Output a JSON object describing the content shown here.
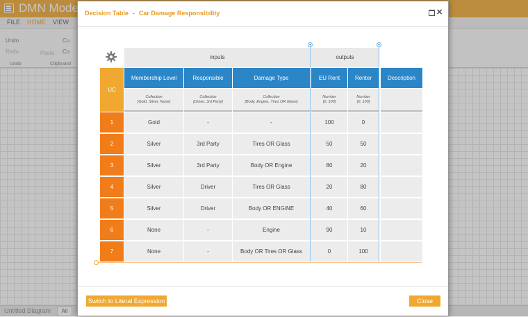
{
  "app": {
    "title": "DMN Modeler",
    "menu": [
      "FILE",
      "HOME",
      "VIEW"
    ],
    "ribbon": {
      "undo": "Undo",
      "redo": "Redo",
      "paste": "Paste",
      "cut": "Cu",
      "copy": "Co",
      "group_undo": "Undo",
      "group_clipboard": "Clipboard"
    },
    "bottom": {
      "diagram_tab": "Untitled Diagram",
      "filter": "All"
    }
  },
  "dialog": {
    "title": "Decision Table",
    "separator": "-",
    "subtitle": "Car Damage Responsibility",
    "switch_button": "Switch to Literal Expression",
    "close_button": "Close",
    "icons": [
      "maximize-icon",
      "close-icon",
      "gear-icon"
    ]
  },
  "table": {
    "hit_policy": "UC",
    "inputs_label": "inputs",
    "outputs_label": "outputs",
    "columns": [
      {
        "label": "Membership Level",
        "type": "Collection",
        "domain": "[Gold, Silver, None]"
      },
      {
        "label": "Responsible",
        "type": "Collection",
        "domain": "[Driver, 3rd Party]"
      },
      {
        "label": "Damage Type",
        "type": "Collection",
        "domain": "[Body, Engine, Tires OR Glass]"
      },
      {
        "label": "EU Rent",
        "type": "Number",
        "domain": "[0, 100]"
      },
      {
        "label": "Renter",
        "type": "Number",
        "domain": "[0, 100]"
      },
      {
        "label": "Description",
        "type": "",
        "domain": ""
      }
    ],
    "rows": [
      {
        "num": "1",
        "cells": [
          "Gold",
          "-",
          "-",
          "100",
          "0",
          ""
        ]
      },
      {
        "num": "2",
        "cells": [
          "Silver",
          "3rd Party",
          "Tires OR Glass",
          "50",
          "50",
          ""
        ]
      },
      {
        "num": "3",
        "cells": [
          "Silver",
          "3rd Party",
          "Body OR Engine",
          "80",
          "20",
          ""
        ]
      },
      {
        "num": "4",
        "cells": [
          "Silver",
          "Driver",
          "Tires OR Glass",
          "20",
          "80",
          ""
        ]
      },
      {
        "num": "5",
        "cells": [
          "Silver",
          "Driver",
          "Body OR ENGINE",
          "40",
          "60",
          ""
        ]
      },
      {
        "num": "6",
        "cells": [
          "None",
          "-",
          "Engine",
          "90",
          "10",
          ""
        ]
      },
      {
        "num": "7",
        "cells": [
          "None",
          "-",
          "Body OR Tires OR Glass",
          "0",
          "100",
          ""
        ]
      }
    ]
  },
  "colors": {
    "accent": "#f0a830",
    "header_blue": "#2b86c8",
    "row_orange": "#f07c1a"
  }
}
